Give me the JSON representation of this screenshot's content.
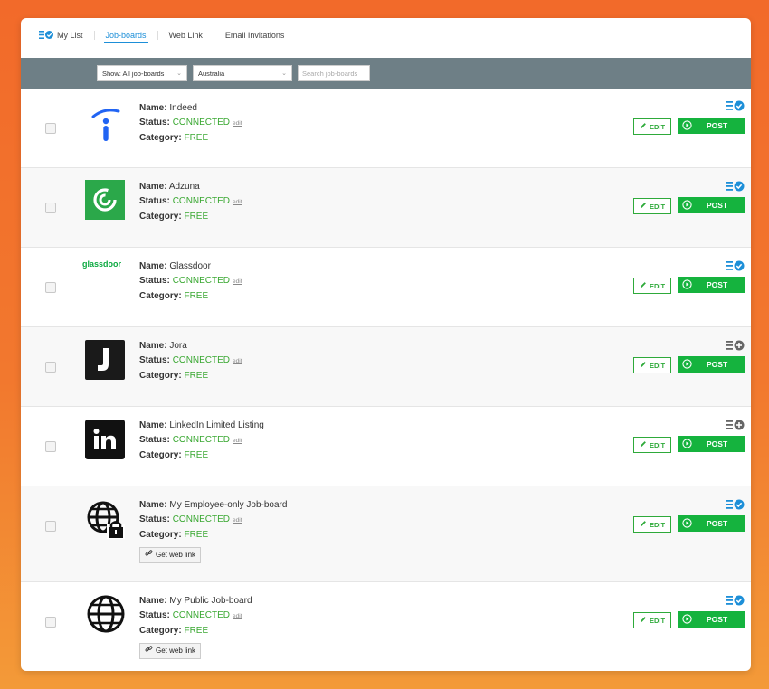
{
  "tabs": [
    {
      "label": "My List"
    },
    {
      "label": "Job-boards"
    },
    {
      "label": "Web Link"
    },
    {
      "label": "Email Invitations"
    }
  ],
  "filters": {
    "show_select": "Show: All job-boards",
    "country_select": "Australia",
    "search_placeholder": "Search job-boards"
  },
  "labels": {
    "name": "Name:",
    "status": "Status:",
    "category": "Category:",
    "edit_link": "edit",
    "edit_button": "EDIT",
    "post_button": "POST",
    "get_web_link": "Get web link"
  },
  "boards": [
    {
      "name": "Indeed",
      "status": "CONNECTED",
      "category": "FREE",
      "listed": true
    },
    {
      "name": "Adzuna",
      "status": "CONNECTED",
      "category": "FREE",
      "listed": true
    },
    {
      "name": "Glassdoor",
      "status": "CONNECTED",
      "category": "FREE",
      "listed": true,
      "logo_text": "glassdoor"
    },
    {
      "name": "Jora",
      "status": "CONNECTED",
      "category": "FREE",
      "listed": false
    },
    {
      "name": "LinkedIn Limited Listing",
      "status": "CONNECTED",
      "category": "FREE",
      "listed": false
    },
    {
      "name": "My Employee-only Job-board",
      "status": "CONNECTED",
      "category": "FREE",
      "listed": true
    },
    {
      "name": "My Public Job-board",
      "status": "CONNECTED",
      "category": "FREE",
      "listed": true
    }
  ],
  "colors": {
    "accent_blue": "#1d8fd8",
    "connected_green": "#3aa832",
    "post_green": "#15b33e",
    "filter_bar": "#6e7f86"
  }
}
